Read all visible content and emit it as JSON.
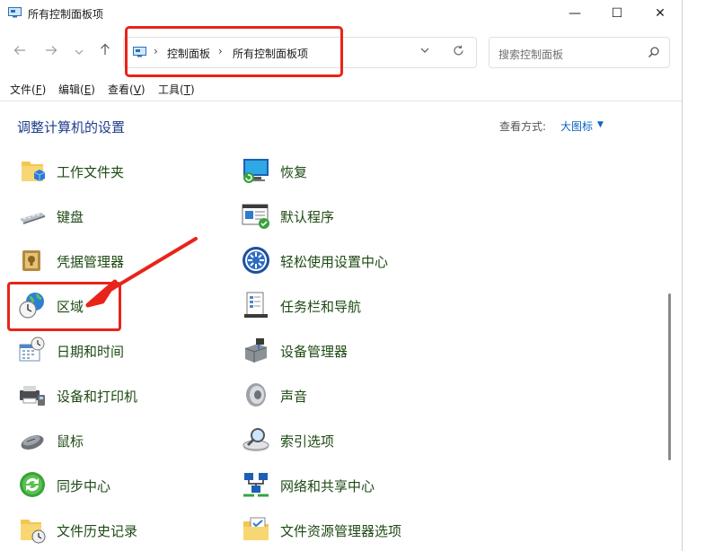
{
  "window": {
    "title": "所有控制面板项",
    "minimize_glyph": "—",
    "maximize_glyph": "☐",
    "close_glyph": "✕"
  },
  "nav": {
    "back_icon": "arrow-left-icon",
    "forward_icon": "arrow-right-icon",
    "recent_icon": "chevron-down-icon",
    "up_icon": "arrow-up-icon"
  },
  "address": {
    "crumbs": [
      "控制面板",
      "所有控制面板项"
    ],
    "separator": "›"
  },
  "search": {
    "placeholder": "搜索控制面板"
  },
  "menu": [
    {
      "label": "文件",
      "key": "F"
    },
    {
      "label": "编辑",
      "key": "E"
    },
    {
      "label": "查看",
      "key": "V"
    },
    {
      "label": "工具",
      "key": "T"
    }
  ],
  "header": {
    "title": "调整计算机的设置",
    "view_label": "查看方式:",
    "view_value": "大图标"
  },
  "items_left": [
    {
      "label": "工作文件夹",
      "icon": "work-folders-icon"
    },
    {
      "label": "键盘",
      "icon": "keyboard-icon"
    },
    {
      "label": "凭据管理器",
      "icon": "credential-manager-icon"
    },
    {
      "label": "区域",
      "icon": "region-globe-clock-icon"
    },
    {
      "label": "日期和时间",
      "icon": "date-time-icon"
    },
    {
      "label": "设备和打印机",
      "icon": "printer-icon"
    },
    {
      "label": "鼠标",
      "icon": "mouse-icon"
    },
    {
      "label": "同步中心",
      "icon": "sync-center-icon"
    },
    {
      "label": "文件历史记录",
      "icon": "file-history-icon"
    }
  ],
  "items_right": [
    {
      "label": "恢复",
      "icon": "recovery-icon"
    },
    {
      "label": "默认程序",
      "icon": "default-programs-icon"
    },
    {
      "label": "轻松使用设置中心",
      "icon": "ease-of-access-icon"
    },
    {
      "label": "任务栏和导航",
      "icon": "taskbar-icon"
    },
    {
      "label": "设备管理器",
      "icon": "device-manager-icon"
    },
    {
      "label": "声音",
      "icon": "sound-icon"
    },
    {
      "label": "索引选项",
      "icon": "indexing-icon"
    },
    {
      "label": "网络和共享中心",
      "icon": "network-icon"
    },
    {
      "label": "文件资源管理器选项",
      "icon": "folder-options-icon"
    }
  ],
  "colors": {
    "annotation_red": "#e8241a",
    "link_blue": "#0b63c5",
    "title_blue": "#1e3d8a",
    "item_green": "#1e4a14"
  }
}
